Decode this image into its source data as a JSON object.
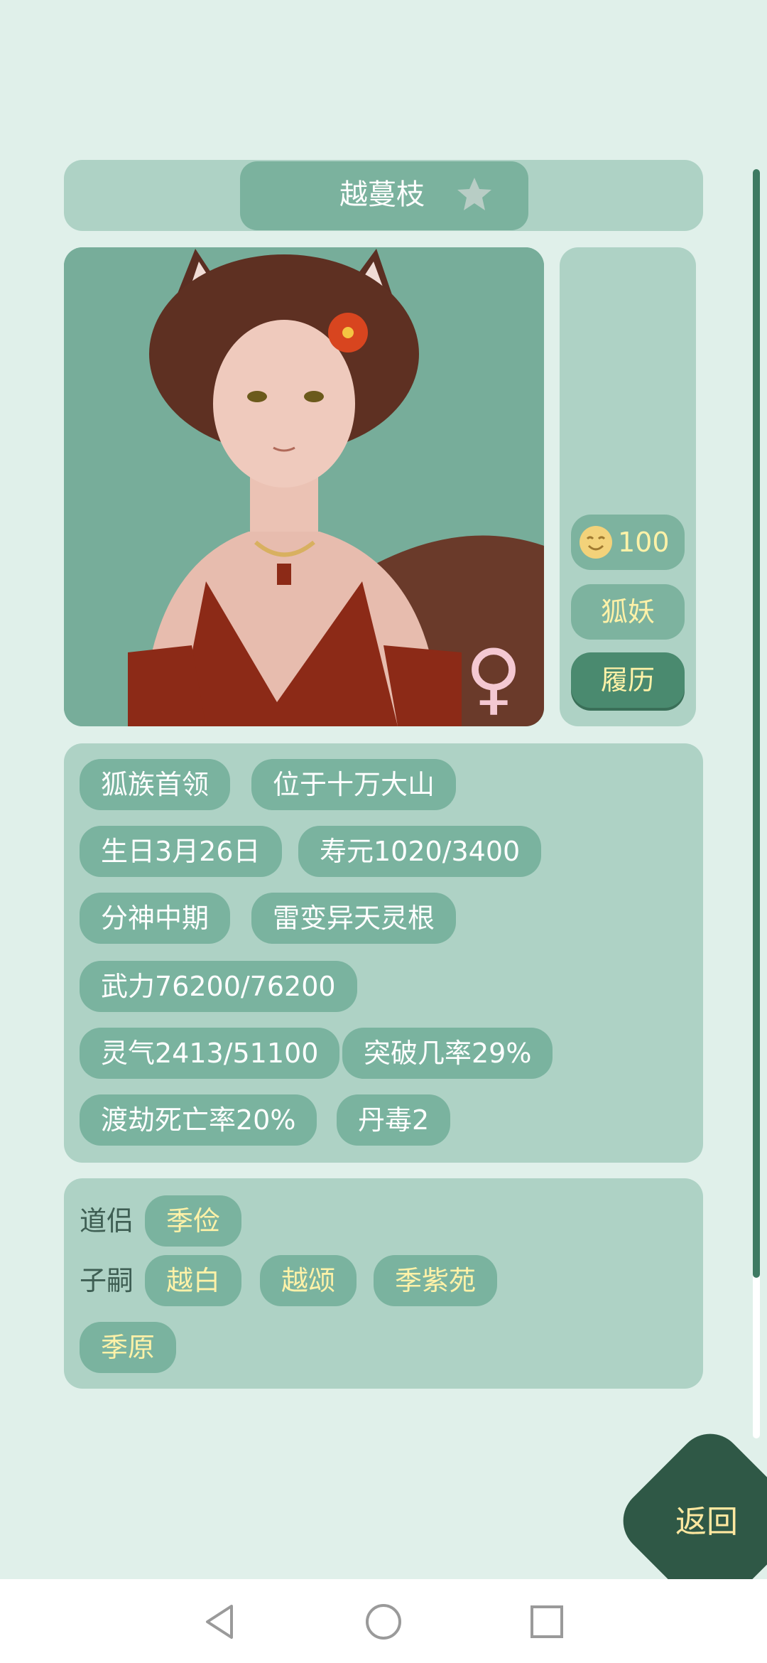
{
  "profile": {
    "name": "越蔓枝",
    "favorite_icon": "star-icon",
    "gender_symbol": "♀",
    "mood_icon": "smiling-face-icon",
    "mood_value": "100",
    "race": "狐妖",
    "history_label": "履历"
  },
  "attributes": [
    "狐族首领",
    "位于十万大山",
    "生日3月26日",
    "寿元1020/3400",
    "分神中期",
    "雷变异天灵根",
    "武力76200/76200",
    "灵气2413/51100",
    "突破几率29%",
    "渡劫死亡率20%",
    "丹毒2"
  ],
  "relations": {
    "partner_label": "道侣",
    "partners": [
      "季俭"
    ],
    "children_label": "子嗣",
    "children": [
      "越白",
      "越颂",
      "季紫苑",
      "季原"
    ]
  },
  "back_label": "返回",
  "colors": {
    "background": "#e0f0ea",
    "card": "#aed2c5",
    "tag": "#7ab39f",
    "accent_text": "#fff2a8",
    "back_button": "#2f5846"
  }
}
